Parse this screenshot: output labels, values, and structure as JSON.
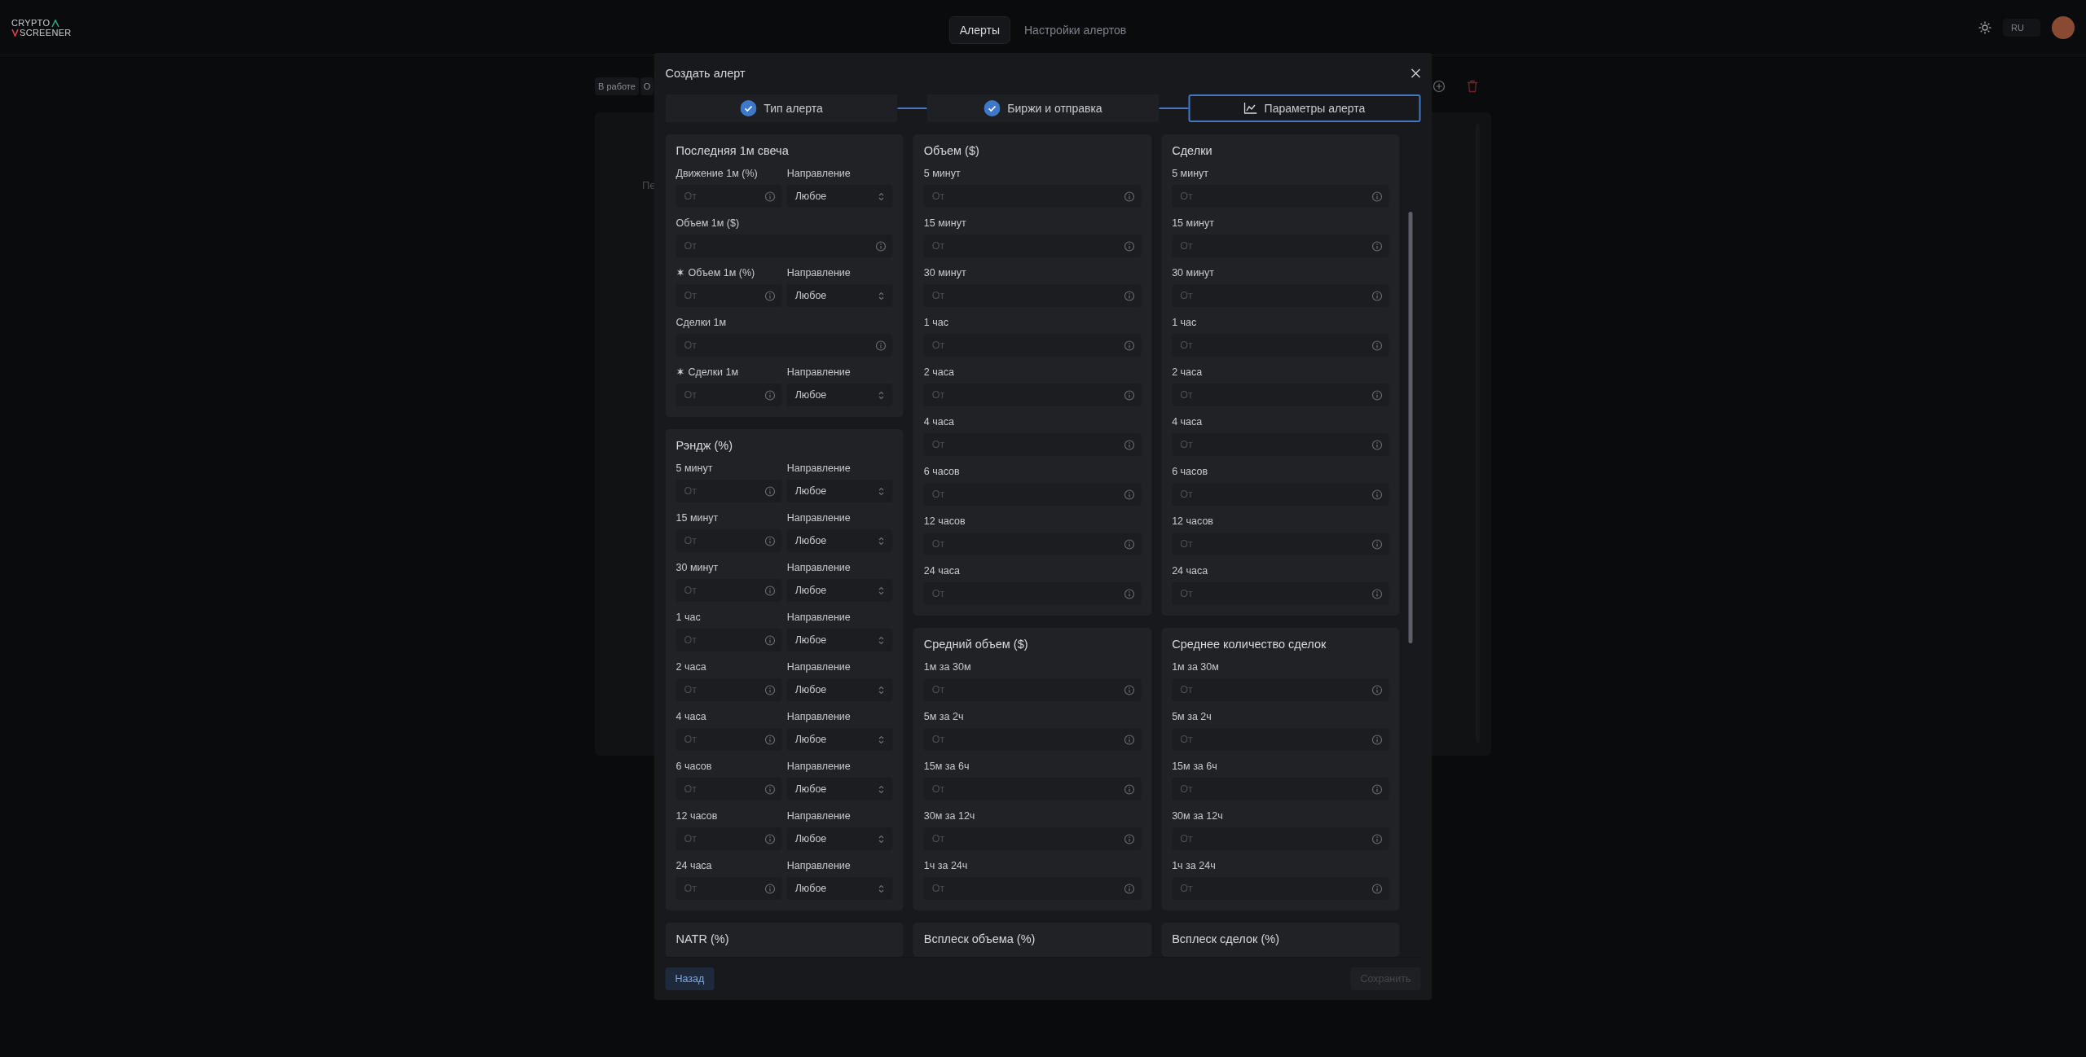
{
  "topbar": {
    "logo": {
      "line1": "CRYPTO",
      "line2": "SCREENER"
    },
    "tabs": [
      {
        "label": "Алерты",
        "selected": true
      },
      {
        "label": "Настройки алертов",
        "selected": false
      }
    ],
    "language": "RU"
  },
  "background": {
    "filters": [
      "В работе",
      "О"
    ],
    "panel_text": "Пе"
  },
  "modal": {
    "title": "Создать алерт",
    "steps": [
      {
        "label": "Тип алерта",
        "done": true,
        "selected": false
      },
      {
        "label": "Биржи и отправка",
        "done": true,
        "selected": false
      },
      {
        "label": "Параметры алерта",
        "done": false,
        "selected": true
      }
    ],
    "columns": [
      [
        {
          "title": "Последняя 1м свеча",
          "fields": [
            {
              "kind": "pair",
              "flagged": false,
              "label": "Движение 1м (%)",
              "placeholder": "От",
              "direction_label": "Направление",
              "direction": "Любое"
            },
            {
              "kind": "single",
              "flagged": false,
              "label": "Объем 1м ($)",
              "placeholder": "От"
            },
            {
              "kind": "pair",
              "flagged": true,
              "label": "Объем 1м (%)",
              "placeholder": "От",
              "direction_label": "Направление",
              "direction": "Любое"
            },
            {
              "kind": "single",
              "flagged": false,
              "label": "Сделки 1м",
              "placeholder": "От"
            },
            {
              "kind": "pair",
              "flagged": true,
              "label": "Сделки 1м",
              "placeholder": "От",
              "direction_label": "Направление",
              "direction": "Любое"
            }
          ]
        },
        {
          "title": "Рэндж (%)",
          "fields": [
            {
              "kind": "pair",
              "flagged": false,
              "label": "5 минут",
              "placeholder": "От",
              "direction_label": "Направление",
              "direction": "Любое"
            },
            {
              "kind": "pair",
              "flagged": false,
              "label": "15 минут",
              "placeholder": "От",
              "direction_label": "Направление",
              "direction": "Любое"
            },
            {
              "kind": "pair",
              "flagged": false,
              "label": "30 минут",
              "placeholder": "От",
              "direction_label": "Направление",
              "direction": "Любое"
            },
            {
              "kind": "pair",
              "flagged": false,
              "label": "1 час",
              "placeholder": "От",
              "direction_label": "Направление",
              "direction": "Любое"
            },
            {
              "kind": "pair",
              "flagged": false,
              "label": "2 часа",
              "placeholder": "От",
              "direction_label": "Направление",
              "direction": "Любое"
            },
            {
              "kind": "pair",
              "flagged": false,
              "label": "4 часа",
              "placeholder": "От",
              "direction_label": "Направление",
              "direction": "Любое"
            },
            {
              "kind": "pair",
              "flagged": false,
              "label": "6 часов",
              "placeholder": "От",
              "direction_label": "Направление",
              "direction": "Любое"
            },
            {
              "kind": "pair",
              "flagged": false,
              "label": "12 часов",
              "placeholder": "От",
              "direction_label": "Направление",
              "direction": "Любое"
            },
            {
              "kind": "pair",
              "flagged": false,
              "label": "24 часа",
              "placeholder": "От",
              "direction_label": "Направление",
              "direction": "Любое"
            }
          ]
        },
        {
          "title": "NATR (%)"
        }
      ],
      [
        {
          "title": "Объем ($)",
          "fields": [
            {
              "kind": "single",
              "flagged": false,
              "label": "5 минут",
              "placeholder": "От"
            },
            {
              "kind": "single",
              "flagged": false,
              "label": "15 минут",
              "placeholder": "От"
            },
            {
              "kind": "single",
              "flagged": false,
              "label": "30 минут",
              "placeholder": "От"
            },
            {
              "kind": "single",
              "flagged": false,
              "label": "1 час",
              "placeholder": "От"
            },
            {
              "kind": "single",
              "flagged": false,
              "label": "2 часа",
              "placeholder": "От"
            },
            {
              "kind": "single",
              "flagged": false,
              "label": "4 часа",
              "placeholder": "От"
            },
            {
              "kind": "single",
              "flagged": false,
              "label": "6 часов",
              "placeholder": "От"
            },
            {
              "kind": "single",
              "flagged": false,
              "label": "12 часов",
              "placeholder": "От"
            },
            {
              "kind": "single",
              "flagged": false,
              "label": "24 часа",
              "placeholder": "От"
            }
          ]
        },
        {
          "title": "Средний объем ($)",
          "fields": [
            {
              "kind": "single",
              "flagged": false,
              "label": "1м за 30м",
              "placeholder": "От"
            },
            {
              "kind": "single",
              "flagged": false,
              "label": "5м за 2ч",
              "placeholder": "От"
            },
            {
              "kind": "single",
              "flagged": false,
              "label": "15м за 6ч",
              "placeholder": "От"
            },
            {
              "kind": "single",
              "flagged": false,
              "label": "30м за 12ч",
              "placeholder": "От"
            },
            {
              "kind": "single",
              "flagged": false,
              "label": "1ч за 24ч",
              "placeholder": "От"
            }
          ]
        },
        {
          "title": "Всплеск объема (%)"
        }
      ],
      [
        {
          "title": "Сделки",
          "fields": [
            {
              "kind": "single",
              "flagged": false,
              "label": "5 минут",
              "placeholder": "От"
            },
            {
              "kind": "single",
              "flagged": false,
              "label": "15 минут",
              "placeholder": "От"
            },
            {
              "kind": "single",
              "flagged": false,
              "label": "30 минут",
              "placeholder": "От"
            },
            {
              "kind": "single",
              "flagged": false,
              "label": "1 час",
              "placeholder": "От"
            },
            {
              "kind": "single",
              "flagged": false,
              "label": "2 часа",
              "placeholder": "От"
            },
            {
              "kind": "single",
              "flagged": false,
              "label": "4 часа",
              "placeholder": "От"
            },
            {
              "kind": "single",
              "flagged": false,
              "label": "6 часов",
              "placeholder": "От"
            },
            {
              "kind": "single",
              "flagged": false,
              "label": "12 часов",
              "placeholder": "От"
            },
            {
              "kind": "single",
              "flagged": false,
              "label": "24 часа",
              "placeholder": "От"
            }
          ]
        },
        {
          "title": "Среднее количество сделок",
          "fields": [
            {
              "kind": "single",
              "flagged": false,
              "label": "1м за 30м",
              "placeholder": "От"
            },
            {
              "kind": "single",
              "flagged": false,
              "label": "5м за 2ч",
              "placeholder": "От"
            },
            {
              "kind": "single",
              "flagged": false,
              "label": "15м за 6ч",
              "placeholder": "От"
            },
            {
              "kind": "single",
              "flagged": false,
              "label": "30м за 12ч",
              "placeholder": "От"
            },
            {
              "kind": "single",
              "flagged": false,
              "label": "1ч за 24ч",
              "placeholder": "От"
            }
          ]
        },
        {
          "title": "Всплеск сделок (%)"
        }
      ]
    ],
    "back_button": {
      "label": "Назад",
      "disabled": false
    },
    "save_button": {
      "label": "Сохранить",
      "disabled": true
    }
  }
}
